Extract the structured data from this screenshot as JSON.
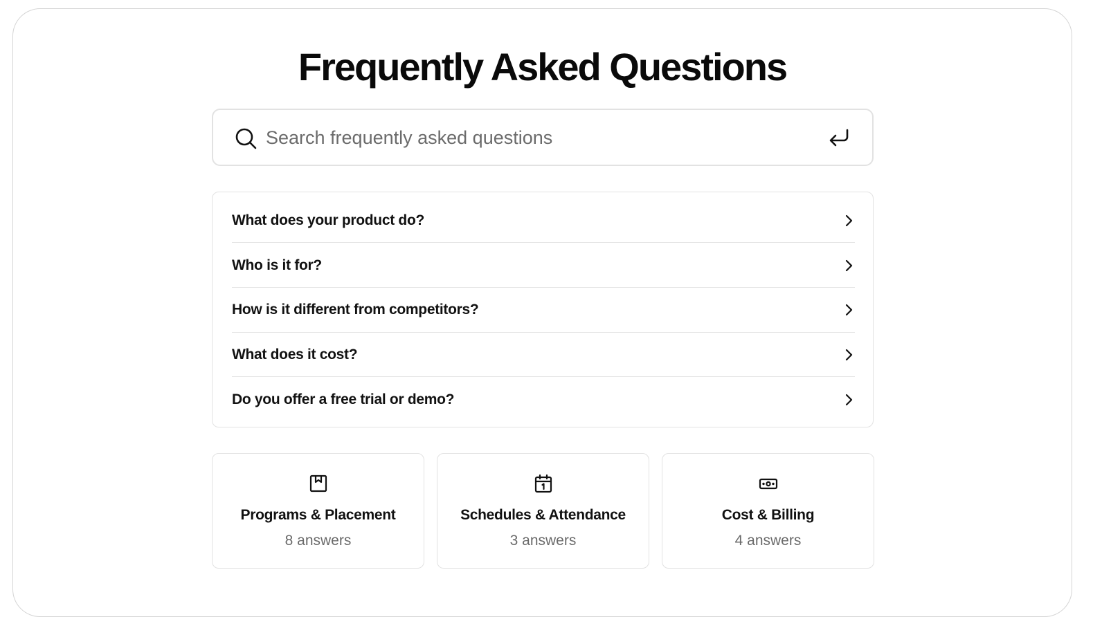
{
  "page": {
    "title": "Frequently Asked Questions"
  },
  "search": {
    "placeholder": "Search frequently asked questions",
    "value": "",
    "icon": "search-icon",
    "submit_icon": "enter-icon"
  },
  "faqs": [
    {
      "question": "What does your product do?",
      "icon": "chevron-right-icon"
    },
    {
      "question": "Who is it for?",
      "icon": "chevron-right-icon"
    },
    {
      "question": "How is it different from competitors?",
      "icon": "chevron-right-icon"
    },
    {
      "question": "What does it cost?",
      "icon": "chevron-right-icon"
    },
    {
      "question": "Do you offer a free trial or demo?",
      "icon": "chevron-right-icon"
    }
  ],
  "categories": [
    {
      "title": "Programs & Placement",
      "count": "8 answers",
      "icon": "bookmark-box-icon"
    },
    {
      "title": "Schedules & Attendance",
      "count": "3 answers",
      "icon": "calendar-icon"
    },
    {
      "title": "Cost & Billing",
      "count": "4 answers",
      "icon": "banknote-icon"
    }
  ]
}
